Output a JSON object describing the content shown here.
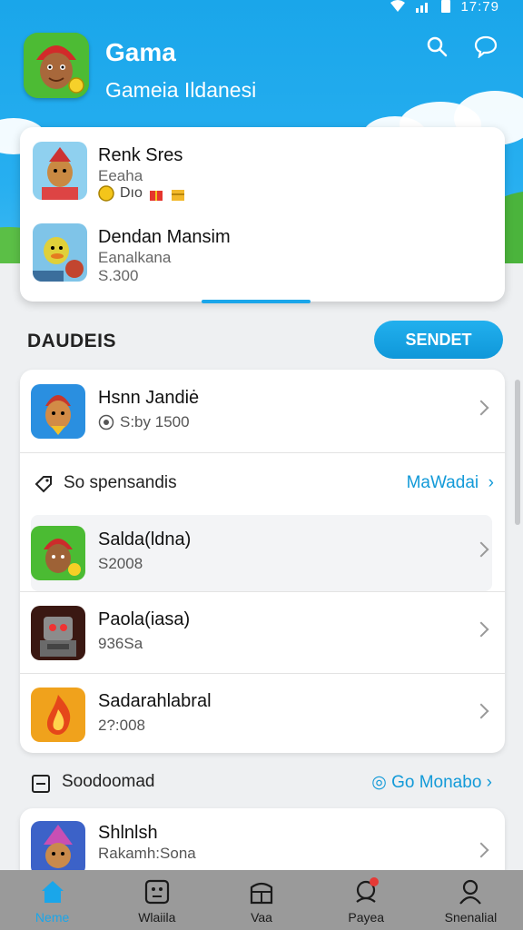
{
  "status_bar": {
    "time": "17:79"
  },
  "header": {
    "title": "Gama",
    "subtitle": "Gameia Ildanesi",
    "search_icon": "search-icon",
    "chat_icon": "chat-bubble-icon"
  },
  "featured": [
    {
      "name": "Renk Sres",
      "sub": "Eeaha",
      "badges": "Dıo",
      "icon": "chef-character-icon"
    },
    {
      "name": "Dendan Mansim",
      "sub": "Eanalkana",
      "price": "S.300",
      "icon": "duck-character-icon"
    }
  ],
  "section": {
    "title": "DAUDEIS",
    "button": "SENDET"
  },
  "list": {
    "top_item": {
      "name": "Hsnn Jandiė",
      "sub": "S:by 1500",
      "icon": "chef-character-icon"
    },
    "subsection": {
      "title": "So spensandis",
      "link": "MaWadai"
    },
    "items": [
      {
        "name": "Salda(ldna)",
        "sub": "S2008",
        "icon": "chef-character-icon"
      },
      {
        "name": "Paola(iasa)",
        "sub": "936Sa",
        "icon": "robot-icon"
      },
      {
        "name": "Sadarahlabral",
        "sub": "2?:008",
        "icon": "fire-icon"
      }
    ]
  },
  "lower": {
    "title": "Soodoomad",
    "link": "Go Monabo",
    "item": {
      "name": "Shlnlsh",
      "sub": "Rakamh:Sona",
      "icon": "wizard-icon"
    }
  },
  "nav": [
    {
      "label": "Neme",
      "icon": "home-icon",
      "active": true
    },
    {
      "label": "Wlaiila",
      "icon": "face-icon",
      "active": false
    },
    {
      "label": "Vaa",
      "icon": "store-icon",
      "active": false
    },
    {
      "label": "Payea",
      "icon": "wallet-icon",
      "active": false
    },
    {
      "label": "Snenalial",
      "icon": "profile-icon",
      "active": false
    }
  ],
  "colors": {
    "accent": "#1aa6ea",
    "header": "#27aff0",
    "nav": "#9a9a9a"
  }
}
